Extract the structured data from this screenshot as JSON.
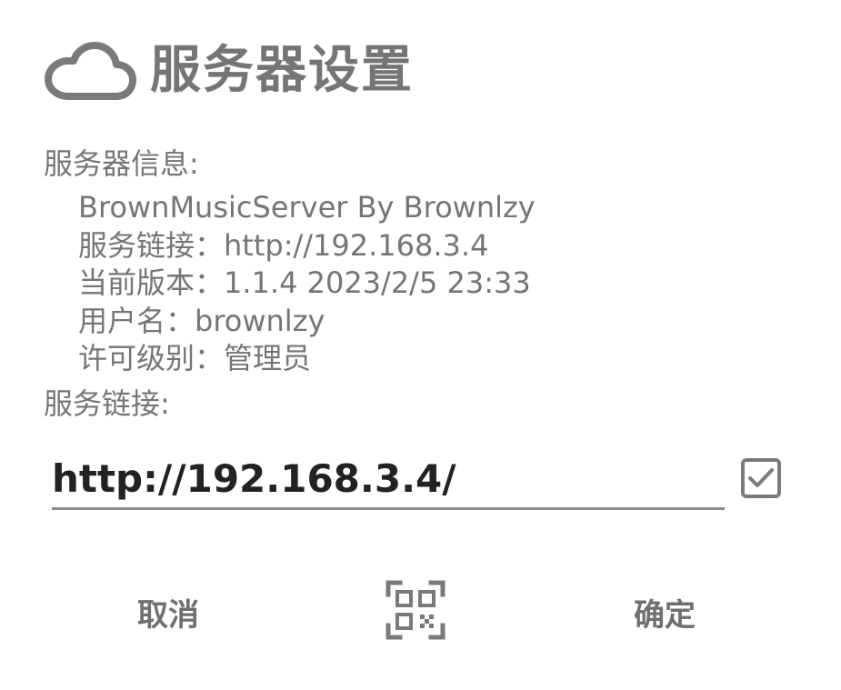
{
  "dialog": {
    "title": "服务器设置",
    "title_icon": "cloud-icon"
  },
  "server_info": {
    "label": "服务器信息:",
    "lines": [
      "BrownMusicServer By Brownlzy",
      "服务链接：http://192.168.3.4",
      "当前版本：1.1.4 2023/2/5 23:33",
      "用户名：brownlzy",
      "许可级别：管理员"
    ]
  },
  "server_link": {
    "label": "服务链接:",
    "value": "http://192.168.3.4/",
    "checkbox_checked": true
  },
  "buttons": {
    "cancel": "取消",
    "scan_icon": "qr-scan-icon",
    "confirm": "确定"
  },
  "colors": {
    "text_gray": "#757575",
    "input_text": "#222222",
    "underline": "#8a8a8a"
  }
}
